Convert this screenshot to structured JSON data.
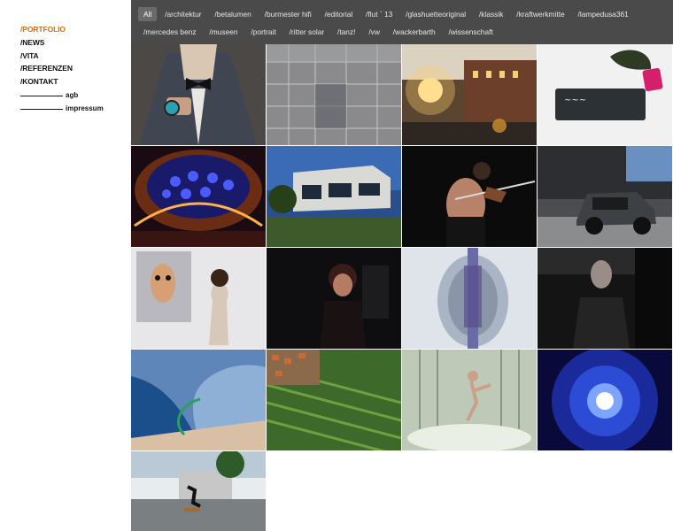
{
  "sidebar": {
    "nav": [
      {
        "label": "/PORTFOLIO",
        "active": true
      },
      {
        "label": "/NEWS",
        "active": false
      },
      {
        "label": "/VITA",
        "active": false
      },
      {
        "label": "/REFERENZEN",
        "active": false
      },
      {
        "label": "/KONTAKT",
        "active": false
      }
    ],
    "legal": [
      {
        "label": "agb"
      },
      {
        "label": "impressum"
      }
    ]
  },
  "filters": {
    "row1": [
      "All",
      "/architektur",
      "/betalumen",
      "/burmester hifi",
      "/editorial",
      "/flut ` 13",
      "/glashuetteoriginal",
      "/klassik",
      "/kraftwerkmitte",
      "/lampedusa361"
    ],
    "row2": [
      "/mercedes benz",
      "/museen",
      "/portrait",
      "/ritter solar",
      "/tanz!",
      "/vw",
      "/wackerbarth",
      "/wissenschaft"
    ],
    "active": "All"
  },
  "gallery": {
    "items": [
      {
        "name": "photo-man-bowtie-watch",
        "icon": "photo"
      },
      {
        "name": "photo-glass-facade",
        "icon": "photo"
      },
      {
        "name": "photo-street-sunset",
        "icon": "photo"
      },
      {
        "name": "photo-chalkboard-plant",
        "icon": "photo"
      },
      {
        "name": "photo-concert-hall-dome",
        "icon": "photo"
      },
      {
        "name": "photo-modern-house",
        "icon": "photo"
      },
      {
        "name": "photo-violinist",
        "icon": "photo"
      },
      {
        "name": "photo-smart-car",
        "icon": "photo"
      },
      {
        "name": "photo-dog-portrait-woman",
        "icon": "photo"
      },
      {
        "name": "photo-woman-laughing",
        "icon": "photo"
      },
      {
        "name": "photo-particle-detector",
        "icon": "photo"
      },
      {
        "name": "photo-man-car-window",
        "icon": "photo"
      },
      {
        "name": "photo-aerial-lake",
        "icon": "photo"
      },
      {
        "name": "photo-vineyard-aerial",
        "icon": "photo"
      },
      {
        "name": "photo-dancer-curtain",
        "icon": "photo"
      },
      {
        "name": "photo-blue-light-swarm",
        "icon": "photo"
      },
      {
        "name": "photo-skater-building",
        "icon": "photo"
      }
    ]
  }
}
